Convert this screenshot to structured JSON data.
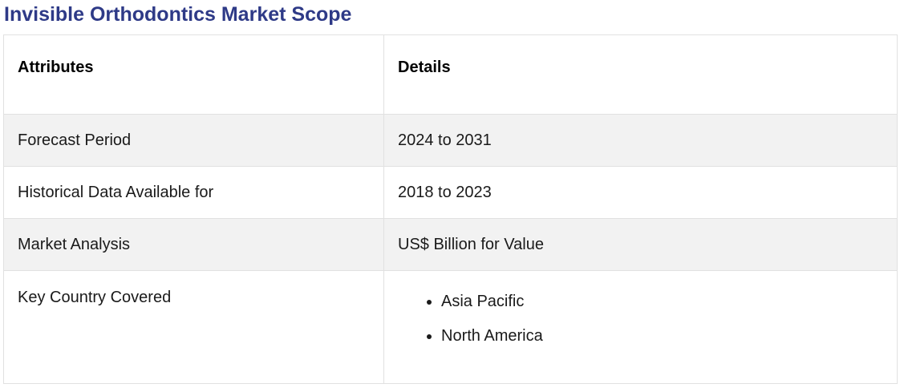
{
  "page": {
    "title": "Invisible Orthodontics Market Scope"
  },
  "table": {
    "headers": {
      "attributes": "Attributes",
      "details": "Details"
    },
    "rows": [
      {
        "attribute": "Forecast Period",
        "detail": "2024 to 2031"
      },
      {
        "attribute": "Historical Data Available for",
        "detail": "2018 to 2023"
      },
      {
        "attribute": "Market Analysis",
        "detail": "US$ Billion for Value"
      }
    ],
    "list_row": {
      "attribute": "Key Country Covered",
      "items": [
        "Asia Pacific",
        "North America"
      ]
    }
  }
}
